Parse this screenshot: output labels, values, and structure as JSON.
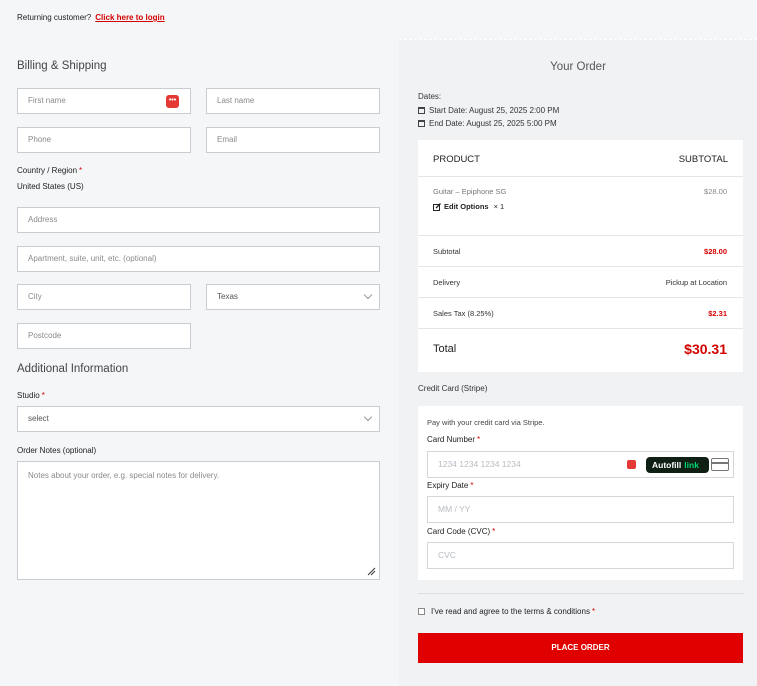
{
  "returning": {
    "text": "Returning customer?",
    "link": "Click here to login"
  },
  "billing": {
    "title": "Billing & Shipping",
    "first_name": "First name",
    "last_name": "Last name",
    "phone": "Phone",
    "email": "Email",
    "country_label": "Country / Region",
    "country_value": "United States (US)",
    "address": "Address",
    "apartment": "Apartment, suite, unit, etc. (optional)",
    "city": "City",
    "state": "Texas",
    "postcode": "Postcode",
    "required_mark": "*"
  },
  "additional": {
    "title": "Additional Information",
    "studio_label": "Studio",
    "studio_value": "select",
    "notes_label": "Order Notes (optional)",
    "notes_placeholder": "Notes about your order, e.g. special notes for delivery."
  },
  "order": {
    "title": "Your Order",
    "dates_label": "Dates:",
    "start": "Start Date: August 25, 2025 2:00 PM",
    "end": "End Date: August 25, 2025 5:00 PM",
    "col_product": "PRODUCT",
    "col_subtotal": "SUBTOTAL",
    "item_name": "Guitar – Epiphone SG",
    "item_price": "$28.00",
    "edit_options": "Edit Options",
    "qty": "× 1",
    "subtotal_label": "Subtotal",
    "subtotal_value": "$28.00",
    "delivery_label": "Delivery",
    "delivery_value": "Pickup at Location",
    "tax_label": "Sales Tax (8.25%)",
    "tax_value": "$2.31",
    "total_label": "Total",
    "total_value": "$30.31"
  },
  "payment": {
    "method": "Credit Card (Stripe)",
    "desc": "Pay with your credit card via Stripe.",
    "card_number_label": "Card Number",
    "card_number_placeholder": "1234 1234 1234 1234",
    "autofill": "Autofill",
    "autofill_link": "link",
    "expiry_label": "Expiry Date",
    "expiry_placeholder": "MM / YY",
    "cvc_label": "Card Code (CVC)",
    "cvc_placeholder": "CVC"
  },
  "terms": "I've read and agree to the terms & conditions",
  "place_order": "PLACE ORDER",
  "colors": {
    "accent": "#e00000",
    "link": "#d40000"
  }
}
